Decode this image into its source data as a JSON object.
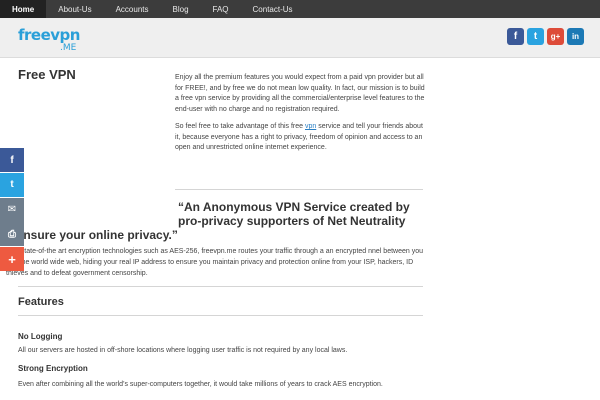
{
  "nav": {
    "items": [
      {
        "label": "Home",
        "active": true
      },
      {
        "label": "About-Us",
        "active": false
      },
      {
        "label": "Accounts",
        "active": false
      },
      {
        "label": "Blog",
        "active": false
      },
      {
        "label": "FAQ",
        "active": false
      },
      {
        "label": "Contact-Us",
        "active": false
      }
    ]
  },
  "header": {
    "logo_main": "freevpn",
    "logo_sub": ".ME",
    "social": [
      {
        "name": "facebook-icon",
        "glyph": "f",
        "color": "#3b5998"
      },
      {
        "name": "twitter-icon",
        "glyph": "t",
        "color": "#2aa3e0"
      },
      {
        "name": "google-plus-icon",
        "glyph": "g+",
        "color": "#dd4b39"
      },
      {
        "name": "linkedin-icon",
        "glyph": "in",
        "color": "#1c79b5"
      }
    ]
  },
  "main": {
    "title": "Free VPN",
    "intro_p1": "Enjoy all the premium features you would expect from a paid vpn provider but all for FREE!, and by free we do not mean low quality. In fact, our mission is to build a free vpn service by providing all the commercial/enterprise level features to the end-user with no charge and no registration required.",
    "intro_p2_before": "So feel free to take advantage of this free ",
    "intro_p2_link": "vpn",
    "intro_p2_after": " service and tell your friends about it, because everyone has a right to privacy, freedom of opinion and access to an open and unrestricted online internet experience.",
    "quote_line1": "“An Anonymous VPN Service created by",
    "quote_line2": "pro-privacy supporters of Net Neutrality",
    "quote_line3": "o ensure your online privacy.”",
    "quote_body": "sing state-of-the art encryption technologies such as AES-256, freevpn.me routes your traffic through a an encrypted nnel between you and the world wide web, hiding your real IP address to ensure you maintain privacy and protection online from your ISP, hackers, ID thieves and to defeat government censorship.",
    "features_title": "Features",
    "features": [
      {
        "title": "No Logging",
        "text": "All our servers are hosted in off-shore locations where logging user traffic is not required by any local laws."
      },
      {
        "title": "Strong Encryption",
        "text": "Even after combining all the world’s super-computers together, it would take millions of years to crack AES encryption."
      }
    ]
  },
  "share_bar": [
    {
      "name": "share-facebook-icon",
      "glyph": "f"
    },
    {
      "name": "share-twitter-icon",
      "glyph": "t"
    },
    {
      "name": "share-email-icon",
      "glyph": "✉"
    },
    {
      "name": "share-print-icon",
      "glyph": "⎙"
    },
    {
      "name": "share-more-icon",
      "glyph": "+"
    }
  ]
}
